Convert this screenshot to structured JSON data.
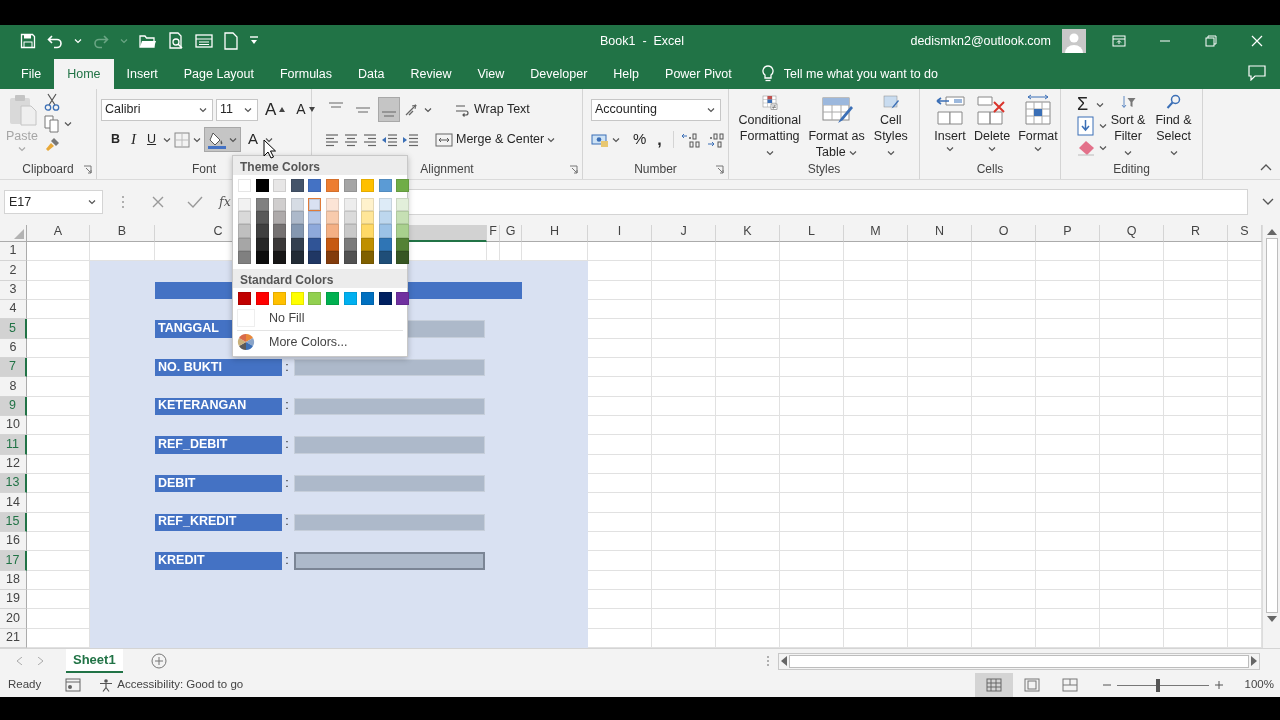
{
  "title_bar": {
    "title": "Book1  -  Excel",
    "account": "dedismkn2@outlook.com"
  },
  "tabs": [
    {
      "label": "File",
      "selected": false
    },
    {
      "label": "Home",
      "selected": true
    },
    {
      "label": "Insert",
      "selected": false
    },
    {
      "label": "Page Layout",
      "selected": false
    },
    {
      "label": "Formulas",
      "selected": false
    },
    {
      "label": "Data",
      "selected": false
    },
    {
      "label": "Review",
      "selected": false
    },
    {
      "label": "View",
      "selected": false
    },
    {
      "label": "Developer",
      "selected": false
    },
    {
      "label": "Help",
      "selected": false
    },
    {
      "label": "Power Pivot",
      "selected": false
    }
  ],
  "tell_me": "Tell me what you want to do",
  "ribbon": {
    "clipboard": {
      "paste": {
        "label": "Paste",
        "disabled": true
      },
      "label": "Clipboard"
    },
    "font": {
      "font_name": "Calibri",
      "font_size": "11",
      "grow_font": "A",
      "shrink_font": "A",
      "bold": "B",
      "italic": "I",
      "underline": "U",
      "font_color": "A",
      "fill_color_pressed": true,
      "label": "Font"
    },
    "alignment": {
      "bottom_align_pressed": true,
      "wrap_text": "Wrap Text",
      "merge_center": "Merge & Center",
      "label": "Alignment"
    },
    "number": {
      "format": "Accounting",
      "percent": "%",
      "comma": ",",
      "label": "Number"
    },
    "styles": {
      "buttons": [
        "Conditional\nFormatting",
        "Format as\nTable",
        "Cell\nStyles"
      ],
      "label": "Styles"
    },
    "cells": {
      "buttons": [
        "Insert",
        "Delete",
        "Format"
      ],
      "label": "Cells"
    },
    "editing": {
      "autosum": "Σ",
      "buttons": [
        "Sort &\nFilter",
        "Find &\nSelect"
      ],
      "label": "Editing"
    }
  },
  "formula_bar": {
    "name_box": "E17",
    "fx": "fx"
  },
  "sheet": {
    "columns": [
      {
        "label": "A",
        "selected": false
      },
      {
        "label": "B",
        "selected": false
      },
      {
        "label": "C",
        "selected": false
      },
      {
        "selected": true
      },
      {
        "label": "F",
        "selected": false
      },
      {
        "label": "G",
        "selected": false
      },
      {
        "label": "H",
        "selected": false
      },
      {
        "label": "I",
        "selected": false
      },
      {
        "label": "J",
        "selected": false
      },
      {
        "label": "K",
        "selected": false
      },
      {
        "label": "L",
        "selected": false
      },
      {
        "label": "M",
        "selected": false
      },
      {
        "label": "N",
        "selected": false
      },
      {
        "label": "O",
        "selected": false
      },
      {
        "label": "P",
        "selected": false
      },
      {
        "label": "Q",
        "selected": false
      },
      {
        "label": "R",
        "selected": false
      },
      {
        "label": "S",
        "selected": false
      }
    ],
    "rows": [
      {
        "label": "1",
        "selected": false
      },
      {
        "label": "2",
        "selected": false
      },
      {
        "label": "3",
        "selected": false
      },
      {
        "label": "4",
        "selected": false
      },
      {
        "label": "5",
        "selected": true
      },
      {
        "label": "6",
        "selected": false
      },
      {
        "label": "7",
        "selected": true
      },
      {
        "label": "8",
        "selected": false
      },
      {
        "label": "9",
        "selected": true
      },
      {
        "label": "10",
        "selected": false
      },
      {
        "label": "11",
        "selected": true
      },
      {
        "label": "12",
        "selected": false
      },
      {
        "label": "13",
        "selected": true
      },
      {
        "label": "14",
        "selected": false
      },
      {
        "label": "15",
        "selected": true
      },
      {
        "label": "16",
        "selected": false
      },
      {
        "label": "17",
        "selected": true
      },
      {
        "label": "18",
        "selected": false
      },
      {
        "label": "19",
        "selected": false
      },
      {
        "label": "20",
        "selected": false
      },
      {
        "label": "21",
        "selected": false
      }
    ],
    "form_fields": [
      {
        "label": "TANGGAL",
        "selected": false
      },
      {
        "label": "NO. BUKTI",
        "separator": ":",
        "selected": false
      },
      {
        "label": "KETERANGAN",
        "separator": ":",
        "selected": false
      },
      {
        "label": "REF_DEBIT",
        "separator": ":",
        "selected": false
      },
      {
        "label": "DEBIT",
        "separator": ":",
        "selected": false
      },
      {
        "label": "REF_KREDIT",
        "separator": ":",
        "selected": false
      },
      {
        "label": "KREDIT",
        "separator": ":",
        "selected": true
      }
    ]
  },
  "color_menu": {
    "theme_title": "Theme Colors",
    "theme_colors": [
      {
        "color": "#ffffff",
        "selected": false
      },
      {
        "color": "#000000",
        "selected": false
      },
      {
        "color": "#e7e6e6",
        "selected": false
      },
      {
        "color": "#44546a",
        "selected": false
      },
      {
        "color": "#4472c4",
        "selected": false
      },
      {
        "color": "#ed7d31",
        "selected": false
      },
      {
        "color": "#a5a5a5",
        "selected": false
      },
      {
        "color": "#ffc000",
        "selected": false
      },
      {
        "color": "#5b9bd5",
        "selected": false
      },
      {
        "color": "#70ad47",
        "selected": false
      }
    ],
    "shades": [
      [
        {
          "color": "#f2f2f2",
          "selected": false
        },
        {
          "color": "#d9d9d9",
          "selected": false
        },
        {
          "color": "#bfbfbf",
          "selected": false
        },
        {
          "color": "#a6a6a6",
          "selected": false
        },
        {
          "color": "#808080",
          "selected": false
        }
      ],
      [
        {
          "color": "#808080",
          "selected": false
        },
        {
          "color": "#595959",
          "selected": false
        },
        {
          "color": "#404040",
          "selected": false
        },
        {
          "color": "#262626",
          "selected": false
        },
        {
          "color": "#0d0d0d",
          "selected": false
        }
      ],
      [
        {
          "color": "#d0cece",
          "selected": false
        },
        {
          "color": "#aeaaaa",
          "selected": false
        },
        {
          "color": "#757171",
          "selected": false
        },
        {
          "color": "#3a3838",
          "selected": false
        },
        {
          "color": "#171616",
          "selected": false
        }
      ],
      [
        {
          "color": "#d6dce4",
          "selected": false
        },
        {
          "color": "#adb9ca",
          "selected": false
        },
        {
          "color": "#8497b0",
          "selected": false
        },
        {
          "color": "#333f4f",
          "selected": false
        },
        {
          "color": "#222b35",
          "selected": false
        }
      ],
      [
        {
          "color": "#d9e1f2",
          "selected": true
        },
        {
          "color": "#b4c6e7",
          "selected": false
        },
        {
          "color": "#8ea9db",
          "selected": false
        },
        {
          "color": "#305496",
          "selected": false
        },
        {
          "color": "#203764",
          "selected": false
        }
      ],
      [
        {
          "color": "#fce4d6",
          "selected": false
        },
        {
          "color": "#f8cbad",
          "selected": false
        },
        {
          "color": "#f4b084",
          "selected": false
        },
        {
          "color": "#c65911",
          "selected": false
        },
        {
          "color": "#833c0c",
          "selected": false
        }
      ],
      [
        {
          "color": "#ededed",
          "selected": false
        },
        {
          "color": "#dbdbdb",
          "selected": false
        },
        {
          "color": "#c9c9c9",
          "selected": false
        },
        {
          "color": "#7b7b7b",
          "selected": false
        },
        {
          "color": "#525252",
          "selected": false
        }
      ],
      [
        {
          "color": "#fff2cc",
          "selected": false
        },
        {
          "color": "#ffe699",
          "selected": false
        },
        {
          "color": "#ffd966",
          "selected": false
        },
        {
          "color": "#bf8f00",
          "selected": false
        },
        {
          "color": "#806000",
          "selected": false
        }
      ],
      [
        {
          "color": "#ddebf7",
          "selected": false
        },
        {
          "color": "#bdd7ee",
          "selected": false
        },
        {
          "color": "#9bc2e6",
          "selected": false
        },
        {
          "color": "#2f75b5",
          "selected": false
        },
        {
          "color": "#1f4e78",
          "selected": false
        }
      ],
      [
        {
          "color": "#e2efda",
          "selected": false
        },
        {
          "color": "#c6e0b4",
          "selected": false
        },
        {
          "color": "#a9d08e",
          "selected": false
        },
        {
          "color": "#548235",
          "selected": false
        },
        {
          "color": "#375623",
          "selected": false
        }
      ]
    ],
    "standard_title": "Standard Colors",
    "standard_colors": [
      {
        "color": "#c00000",
        "selected": false
      },
      {
        "color": "#ff0000",
        "selected": false
      },
      {
        "color": "#ffc000",
        "selected": false
      },
      {
        "color": "#ffff00",
        "selected": false
      },
      {
        "color": "#92d050",
        "selected": false
      },
      {
        "color": "#00b050",
        "selected": false
      },
      {
        "color": "#00b0f0",
        "selected": false
      },
      {
        "color": "#0070c0",
        "selected": false
      },
      {
        "color": "#002060",
        "selected": false
      },
      {
        "color": "#7030a0",
        "selected": false
      }
    ],
    "no_fill": "No Fill",
    "more_colors": "More Colors..."
  },
  "sheet_tabs": [
    {
      "label": "Sheet1",
      "selected": true
    }
  ],
  "status_bar": {
    "status": "Ready",
    "accessibility": "Accessibility: Good to go",
    "views": [
      {
        "kind": "normal",
        "selected": true
      },
      {
        "kind": "page-layout",
        "selected": false
      },
      {
        "kind": "page-break",
        "selected": false
      }
    ],
    "zoom": {
      "level": 0.45,
      "reading": "100%"
    }
  }
}
